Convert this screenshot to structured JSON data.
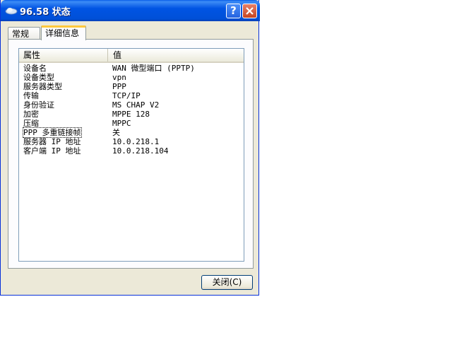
{
  "window": {
    "title": "96.58 状态",
    "help_glyph": "?",
    "close_glyph": "✕"
  },
  "tabs": [
    {
      "label": "常规",
      "selected": false
    },
    {
      "label": "详细信息",
      "selected": true
    }
  ],
  "details": {
    "columns": {
      "property": "属性",
      "value": "值"
    },
    "rows": [
      {
        "property": "设备名",
        "value": "WAN 微型端口 (PPTP)"
      },
      {
        "property": "设备类型",
        "value": "vpn"
      },
      {
        "property": "服务器类型",
        "value": "PPP"
      },
      {
        "property": "传输",
        "value": "TCP/IP"
      },
      {
        "property": "身份验证",
        "value": "MS CHAP V2"
      },
      {
        "property": "加密",
        "value": "MPPE 128"
      },
      {
        "property": "压缩",
        "value": "MPPC"
      },
      {
        "property": "PPP 多重链接帧",
        "value": "关"
      },
      {
        "property": "服务器 IP 地址",
        "value": "10.0.218.1"
      },
      {
        "property": "客户端 IP 地址",
        "value": "10.0.218.104"
      }
    ]
  },
  "buttons": {
    "close_label": "关闭(C)"
  },
  "colors": {
    "titlebar": "#0054e3",
    "window_body": "#ece9d8",
    "tab_highlight": "#ffc83c",
    "close_button": "#c74521"
  },
  "icons": {
    "title": "network-connection-icon",
    "help": "help-icon",
    "close": "close-icon"
  }
}
